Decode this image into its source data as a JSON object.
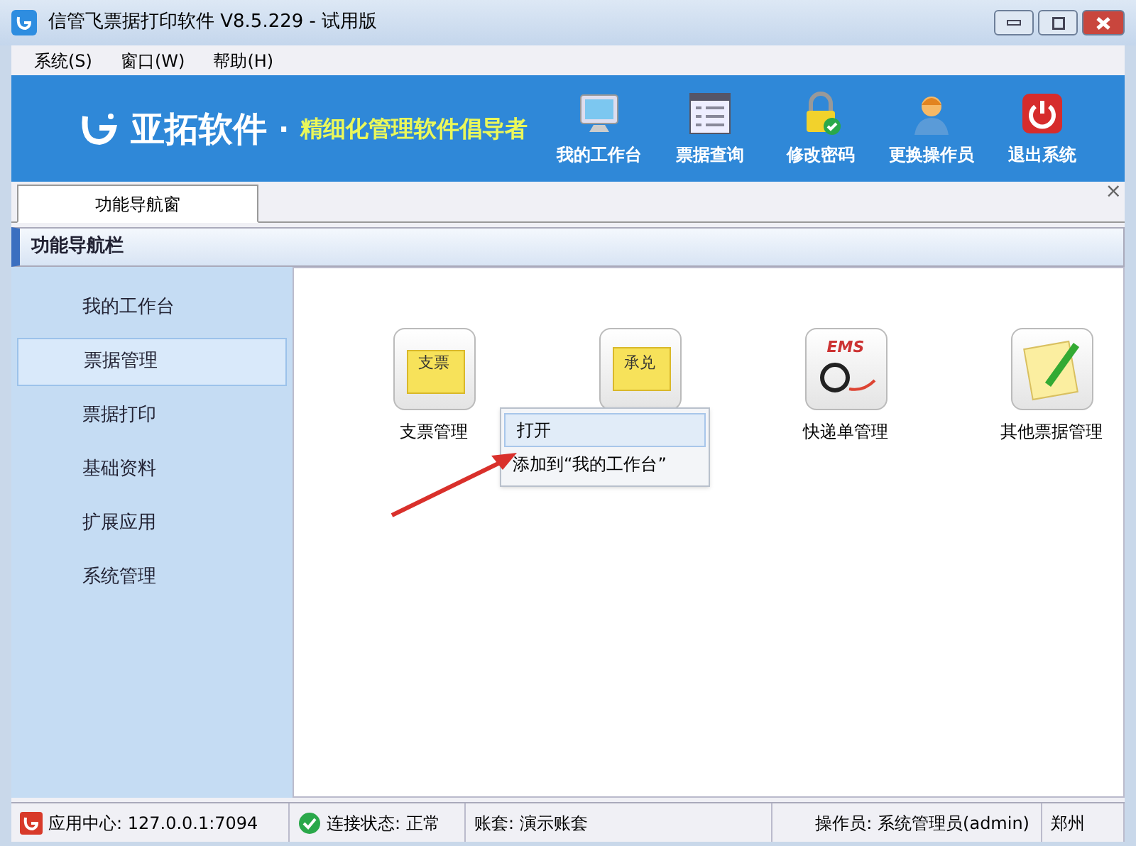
{
  "window": {
    "title": "信管飞票据打印软件 V8.5.229 - 试用版"
  },
  "menu": [
    "系统(S)",
    "窗口(W)",
    "帮助(H)"
  ],
  "banner": {
    "brand": "亚拓软件",
    "dot": "·",
    "slogan": "精细化管理软件倡导者"
  },
  "toolbar": [
    {
      "kind": "monitor",
      "label": "我的工作台"
    },
    {
      "kind": "list",
      "label": "票据查询"
    },
    {
      "kind": "lock",
      "label": "修改密码"
    },
    {
      "kind": "user",
      "label": "更换操作员"
    },
    {
      "kind": "power",
      "label": "退出系统"
    }
  ],
  "tabs": [
    {
      "label": "功能导航窗",
      "selected": true
    }
  ],
  "close": "×",
  "nav": {
    "title": "功能导航栏",
    "items": [
      {
        "label": "我的工作台",
        "selected": false
      },
      {
        "label": "票据管理",
        "selected": true
      },
      {
        "label": "票据打印",
        "selected": false
      },
      {
        "label": "基础资料",
        "selected": false
      },
      {
        "label": "扩展应用",
        "selected": false
      },
      {
        "label": "系统管理",
        "selected": false
      }
    ]
  },
  "tiles": [
    {
      "kind": "cheque",
      "icon_text": "支票",
      "label": "支票管理"
    },
    {
      "kind": "accept",
      "icon_text": "承兑"
    },
    {
      "kind": "express",
      "icon_text": "EMS",
      "label": "快递单管理"
    },
    {
      "kind": "note",
      "label": "其他票据管理"
    }
  ],
  "context_menu": [
    "打开",
    "添加到“我的工作台”"
  ],
  "status_bar": [
    "应用中心: 127.0.0.1:7094",
    "连接状态: 正常",
    "账套: 演示账套",
    "操作员: 系统管理员(admin)",
    "郑州"
  ]
}
